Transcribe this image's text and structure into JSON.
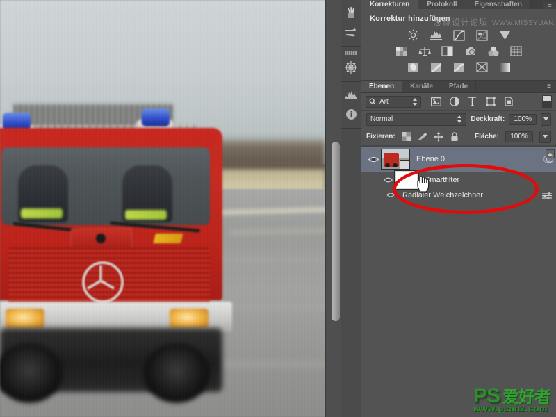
{
  "app": {
    "name": "Adobe Photoshop",
    "language": "de"
  },
  "canvas": {
    "name": "document-canvas",
    "image_description": "Blurred red Mercedes fire truck driving on a road, radial blur applied",
    "scrollbar": {
      "name": "vertical-scrollbar",
      "thumb_position": "middle"
    }
  },
  "dock": {
    "items": [
      {
        "label": "Werkzeugvorgaben",
        "icon": "brush-presets-icon"
      },
      {
        "label": "Pinselvorgaben",
        "icon": "brush-icon"
      },
      {
        "label": "Kuler",
        "icon": "snowflake-icon"
      },
      {
        "label": "Histogramm",
        "icon": "histogram-icon"
      },
      {
        "label": "Info",
        "icon": "info-icon"
      }
    ]
  },
  "top_panel": {
    "tabs": [
      {
        "label": "Korrekturen",
        "active": true
      },
      {
        "label": "Protokoll",
        "active": false
      },
      {
        "label": "Eigenschaften",
        "active": false
      }
    ],
    "menu_icon": "panel-menu-icon",
    "title": "Korrektur hinzufügen",
    "adjustments": [
      [
        {
          "label": "Helligkeit/Kontrast",
          "icon": "brightness-contrast-icon"
        },
        {
          "label": "Tonwertkorrektur",
          "icon": "levels-icon"
        },
        {
          "label": "Gradationskurven",
          "icon": "curves-icon"
        },
        {
          "label": "Belichtung",
          "icon": "exposure-icon"
        },
        {
          "label": "Dynamik",
          "icon": "vibrance-icon"
        }
      ],
      [
        {
          "label": "Farbton/Sättigung",
          "icon": "hue-saturation-icon"
        },
        {
          "label": "Farbbalance",
          "icon": "color-balance-icon"
        },
        {
          "label": "Schwarzweiß",
          "icon": "black-white-icon"
        },
        {
          "label": "Fotofilter",
          "icon": "photo-filter-icon"
        },
        {
          "label": "Kanalmixer",
          "icon": "channel-mixer-icon"
        },
        {
          "label": "Farbsuche",
          "icon": "color-lookup-icon"
        }
      ],
      [
        {
          "label": "Umkehren",
          "icon": "invert-icon"
        },
        {
          "label": "Tontrennung",
          "icon": "posterize-icon"
        },
        {
          "label": "Schwellenwert",
          "icon": "threshold-icon"
        },
        {
          "label": "Selektive Farbkorrektur",
          "icon": "selective-color-icon"
        },
        {
          "label": "Verlaufsumsetzung",
          "icon": "gradient-map-icon"
        }
      ]
    ]
  },
  "watermarks": {
    "top": {
      "cn": "思缘设计论坛",
      "en": "WWW.MISSYUAN.COM"
    },
    "bottom": {
      "ps": "PS",
      "cn": "爱好者",
      "url": "www.psahz.com"
    }
  },
  "layers_panel": {
    "tabs": [
      {
        "label": "Ebenen",
        "active": true
      },
      {
        "label": "Kanäle",
        "active": false
      },
      {
        "label": "Pfade",
        "active": false
      }
    ],
    "menu_icon": "panel-menu-icon",
    "filter": {
      "kind_label": "Art",
      "search_icon": "search-icon",
      "stepper_icon": "stepper-icon",
      "type_filters": [
        {
          "label": "Pixel",
          "icon": "image-filter-icon"
        },
        {
          "label": "Einstellung",
          "icon": "adjustment-filter-icon"
        },
        {
          "label": "Text",
          "icon": "text-filter-icon"
        },
        {
          "label": "Form",
          "icon": "shape-filter-icon"
        },
        {
          "label": "Smartobjekt",
          "icon": "smart-object-filter-icon"
        }
      ],
      "toggle": {
        "label": "Filter ein/aus",
        "icon": "filter-toggle-icon"
      }
    },
    "blend": {
      "mode": "Normal",
      "opacity_label": "Deckkraft:",
      "opacity_value": "100%"
    },
    "lock": {
      "label": "Fixieren:",
      "icons": [
        {
          "label": "Transparente Pixel fixieren",
          "icon": "lock-transparency-icon"
        },
        {
          "label": "Bildpixel fixieren",
          "icon": "lock-pixels-icon"
        },
        {
          "label": "Position fixieren",
          "icon": "lock-position-icon"
        },
        {
          "label": "Alles fixieren",
          "icon": "lock-all-icon"
        }
      ],
      "fill_label": "Fläche:",
      "fill_value": "100%"
    },
    "layers": [
      {
        "name": "Ebene 0",
        "visible": true,
        "selected": true,
        "thumb": "fire-truck-thumbnail",
        "smart_object": true,
        "right_icon": "smart-filter-effects-icon",
        "children": [
          {
            "name": "Smartfilter",
            "type": "smart-filter-mask",
            "visible": true,
            "mask": "white-mask-thumbnail"
          },
          {
            "name": "Radialer Weichzeichner",
            "type": "filter",
            "visible": true,
            "right_icon": "filter-settings-icon"
          }
        ]
      }
    ],
    "scroll_arrow_icon": "scroll-up-arrow-icon"
  },
  "annotation": {
    "name": "red-ellipse-highlight",
    "color": "#e00c0c",
    "targets": "Smartfilter / Radialer Weichzeichner"
  },
  "cursor": {
    "name": "hand-cursor",
    "icon": "hand-icon"
  }
}
